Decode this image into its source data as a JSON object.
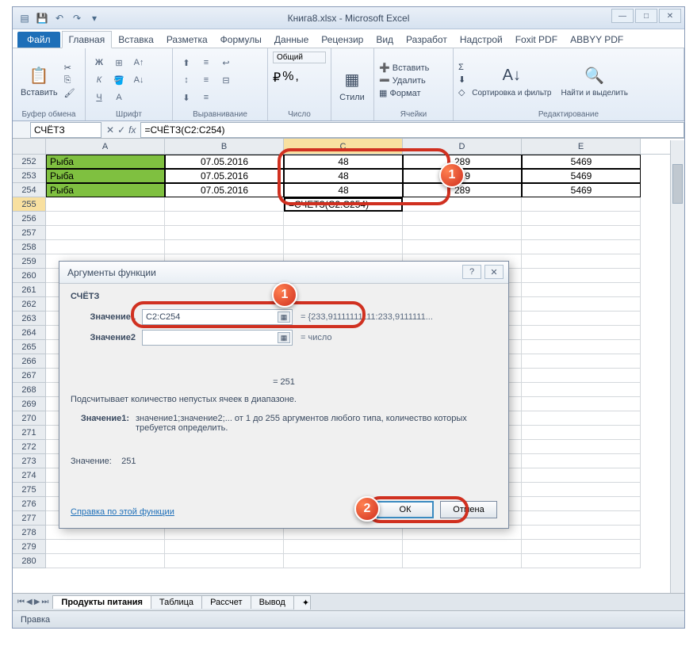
{
  "app": {
    "title": "Книга8.xlsx - Microsoft Excel"
  },
  "qat": {
    "save": "💾",
    "undo": "↶",
    "redo": "↷"
  },
  "winbtns": {
    "min": "—",
    "max": "□",
    "close": "✕"
  },
  "tabs": {
    "file": "Файл",
    "home": "Главная",
    "insert": "Вставка",
    "layout": "Разметка",
    "formulas": "Формулы",
    "data": "Данные",
    "review": "Рецензир",
    "view": "Вид",
    "developer": "Разработ",
    "addins": "Надстрой",
    "foxit": "Foxit PDF",
    "abbyy": "ABBYY PDF"
  },
  "ribbon": {
    "clipboard": {
      "label": "Буфер обмена",
      "paste": "Вставить"
    },
    "font": {
      "label": "Шрифт"
    },
    "alignment": {
      "label": "Выравнивание"
    },
    "number": {
      "label": "Число",
      "format": "Общий"
    },
    "styles": {
      "label": "Стили",
      "btn": "Стили"
    },
    "cells": {
      "label": "Ячейки",
      "insert": "Вставить",
      "delete": "Удалить",
      "format": "Формат"
    },
    "editing": {
      "label": "Редактирование",
      "sort": "Сортировка и фильтр",
      "find": "Найти и выделить",
      "sigma": "Σ",
      "fill": "⬇",
      "clear": "◇"
    }
  },
  "namebox": "СЧЁТЗ",
  "formula": "=СЧЁТЗ(C2:C254)",
  "cols": [
    "A",
    "B",
    "C",
    "D",
    "E"
  ],
  "rows": [
    {
      "n": "252",
      "a": "Рыба",
      "b": "07.05.2016",
      "c": "48",
      "d": "289",
      "e": "5469"
    },
    {
      "n": "253",
      "a": "Рыба",
      "b": "07.05.2016",
      "c": "48",
      "d": "289",
      "e": "5469"
    },
    {
      "n": "254",
      "a": "Рыба",
      "b": "07.05.2016",
      "c": "48",
      "d": "289",
      "e": "5469"
    }
  ],
  "active_row": "255",
  "active_cell": "=СЧЕТЗ(C2:C254)",
  "empty_rows": [
    "256",
    "257",
    "258",
    "259",
    "260",
    "261",
    "262",
    "263",
    "264",
    "265",
    "266",
    "267",
    "268",
    "269",
    "270",
    "271",
    "272",
    "273",
    "274",
    "275",
    "276",
    "277",
    "278",
    "279",
    "280"
  ],
  "sheets": {
    "s1": "Продукты питания",
    "s2": "Таблица",
    "s3": "Рассчет",
    "s4": "Вывод"
  },
  "status": "Правка",
  "dialog": {
    "title": "Аргументы функции",
    "func": "СЧЁТЗ",
    "arg1_label": "Значение1",
    "arg1_value": "C2:C254",
    "arg1_preview": "= {233,91111111111:233,9111111...",
    "arg2_label": "Значение2",
    "arg2_value": "",
    "arg2_preview": "= число",
    "result_eq": "= 251",
    "desc": "Подсчитывает количество непустых ячеек в диапазоне.",
    "arg_desc_label": "Значение1:",
    "arg_desc_text": "значение1;значение2;... от 1 до 255 аргументов любого типа, количество которых требуется определить.",
    "value_label": "Значение:",
    "value": "251",
    "help": "Справка по этой функции",
    "ok": "ОК",
    "cancel": "Отмена"
  }
}
